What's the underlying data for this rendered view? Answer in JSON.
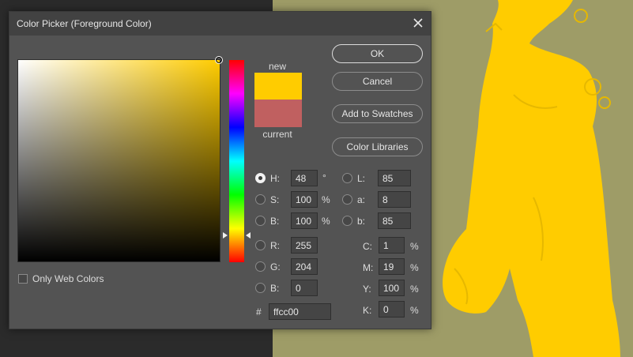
{
  "dialog": {
    "title": "Color Picker (Foreground Color)",
    "only_web_colors_label": "Only Web Colors",
    "new_label": "new",
    "current_label": "current",
    "new_color": "#ffcc00",
    "current_color": "#c06060"
  },
  "buttons": {
    "ok": "OK",
    "cancel": "Cancel",
    "add_to_swatches": "Add to Swatches",
    "color_libraries": "Color Libraries"
  },
  "hsb": {
    "h_label": "H:",
    "h_value": "48",
    "h_unit": "°",
    "s_label": "S:",
    "s_value": "100",
    "s_unit": "%",
    "b_label": "B:",
    "b_value": "100",
    "b_unit": "%"
  },
  "lab": {
    "l_label": "L:",
    "l_value": "85",
    "a_label": "a:",
    "a_value": "8",
    "b_label": "b:",
    "b_value": "85"
  },
  "rgb": {
    "r_label": "R:",
    "r_value": "255",
    "g_label": "G:",
    "g_value": "204",
    "b_label": "B:",
    "b_value": "0"
  },
  "cmyk": {
    "c_label": "C:",
    "c_value": "1",
    "c_unit": "%",
    "m_label": "M:",
    "m_value": "19",
    "m_unit": "%",
    "y_label": "Y:",
    "y_value": "100",
    "y_unit": "%",
    "k_label": "K:",
    "k_value": "0",
    "k_unit": "%"
  },
  "hex": {
    "label": "#",
    "value": "ffcc00"
  },
  "colors": {
    "dialog_bg": "#535353",
    "titlebar_bg": "#424242",
    "canvas_olive": "#9e9c67",
    "figure_yellow": "#ffcc00"
  },
  "icons": {
    "close": "close-icon"
  }
}
